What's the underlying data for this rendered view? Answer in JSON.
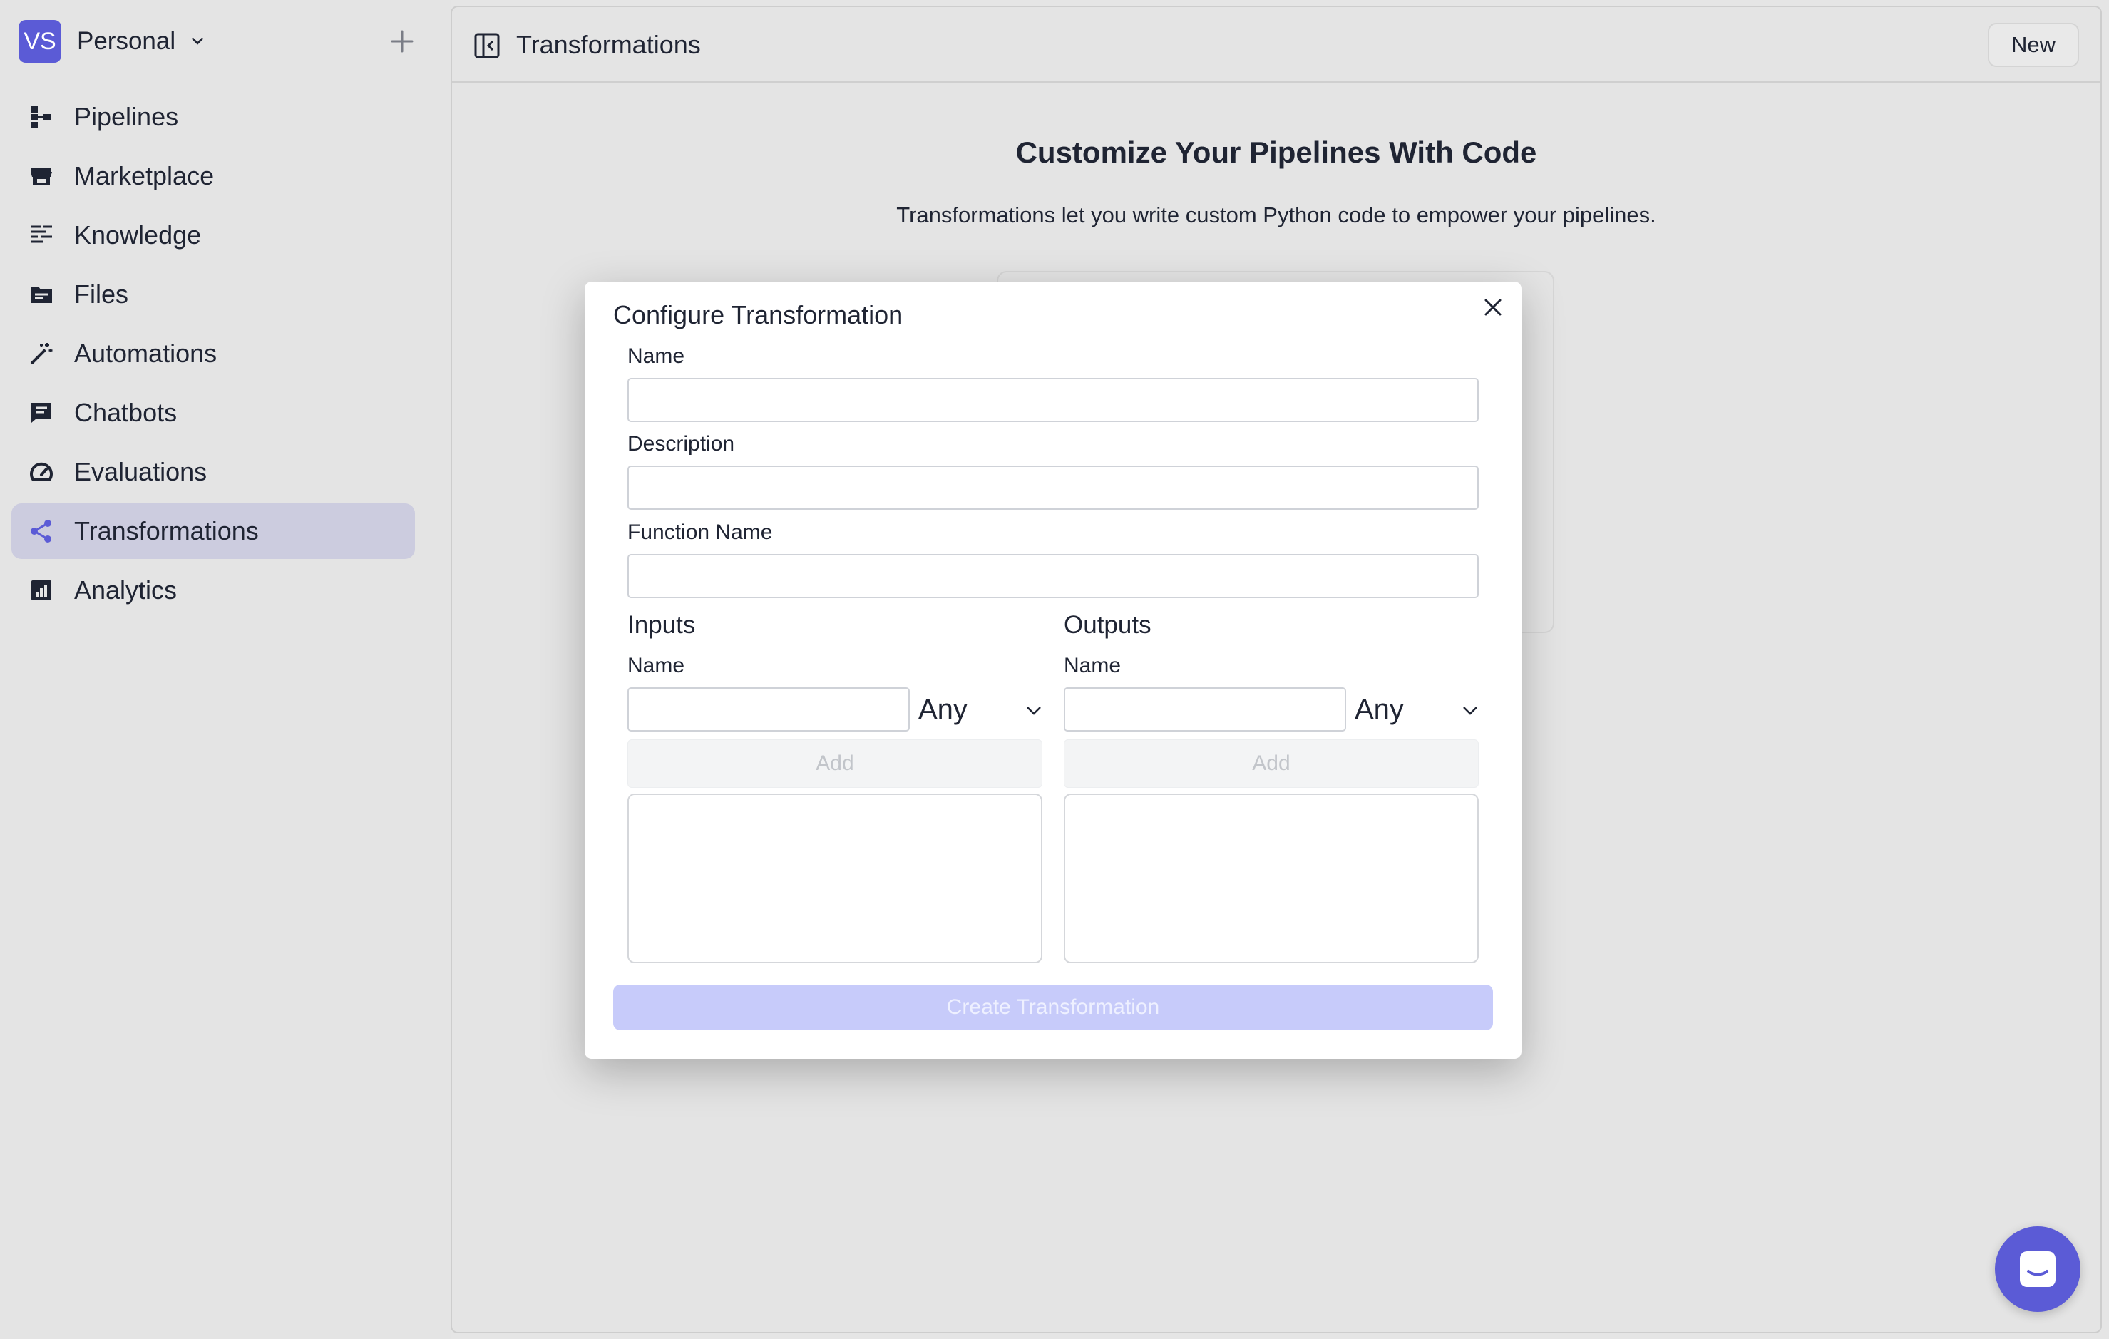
{
  "workspace": {
    "initials": "VS",
    "name": "Personal"
  },
  "sidebar": {
    "items": [
      {
        "label": "Pipelines",
        "icon": "pipelines-icon"
      },
      {
        "label": "Marketplace",
        "icon": "store-icon"
      },
      {
        "label": "Knowledge",
        "icon": "knowledge-icon"
      },
      {
        "label": "Files",
        "icon": "folder-icon"
      },
      {
        "label": "Automations",
        "icon": "magic-wand-icon"
      },
      {
        "label": "Chatbots",
        "icon": "chat-icon"
      },
      {
        "label": "Evaluations",
        "icon": "gauge-icon"
      },
      {
        "label": "Transformations",
        "icon": "share-nodes-icon",
        "active": true
      },
      {
        "label": "Analytics",
        "icon": "bar-chart-icon"
      }
    ]
  },
  "header": {
    "title": "Transformations",
    "new_label": "New"
  },
  "hero": {
    "title": "Customize Your Pipelines With Code",
    "subtitle": "Transformations let you write custom Python code to empower your pipelines."
  },
  "modal": {
    "title": "Configure Transformation",
    "fields": {
      "name_label": "Name",
      "name_value": "",
      "description_label": "Description",
      "description_value": "",
      "function_label": "Function Name",
      "function_value": ""
    },
    "inputs": {
      "title": "Inputs",
      "name_label": "Name",
      "name_value": "",
      "type": "Any",
      "add_label": "Add"
    },
    "outputs": {
      "title": "Outputs",
      "name_label": "Name",
      "name_value": "",
      "type": "Any",
      "add_label": "Add"
    },
    "create_label": "Create Transformation"
  },
  "colors": {
    "accent": "#5b5bd6",
    "active_nav_bg": "#ccccdf",
    "create_disabled": "#c7cbfa"
  }
}
